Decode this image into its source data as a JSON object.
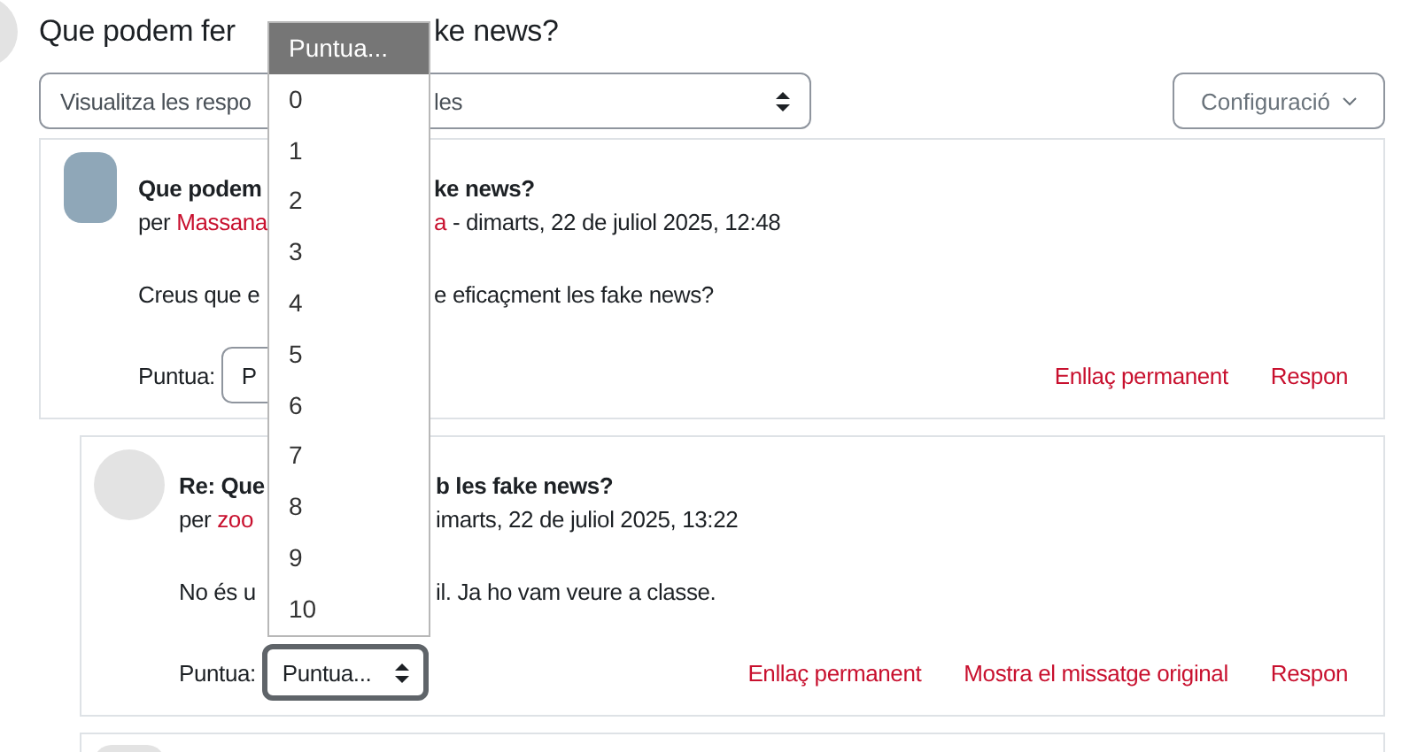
{
  "page_title": [
    "Que podem fer",
    "ke news?"
  ],
  "display_select": [
    "Visualitza les respo",
    "les"
  ],
  "settings_button": "Configuració",
  "posts": [
    {
      "photo": true,
      "subject": [
        "Que podem",
        "ke news?"
      ],
      "byline": {
        "prefix": "per",
        "author": "Massana",
        "author_end": "a",
        "date": " - dimarts, 22 de juliol 2025, 12:48"
      },
      "body": [
        "Creus que e",
        "e eficaçment les fake news?"
      ],
      "rating": {
        "label": "Puntua:",
        "value": "P",
        "focused": false
      },
      "actions": [
        "Enllaç permanent",
        "Respon"
      ],
      "children": [
        {
          "photo": false,
          "subject": [
            "Re: Que",
            "b les fake news?"
          ],
          "byline": {
            "prefix": "per",
            "author": "zoo",
            "date": "imarts, 22 de juliol 2025, 13:22"
          },
          "body": [
            "No és u",
            "il. Ja ho vam veure a classe."
          ],
          "rating": {
            "label": "Puntua:",
            "value": "Puntua...",
            "focused": true
          },
          "actions": [
            "Enllaç permanent",
            "Mostra el missatge original",
            "Respon"
          ]
        },
        {
          "photo": false,
          "cut_off": true
        }
      ]
    }
  ],
  "rating_menu": {
    "options": [
      {
        "label": "Puntua...",
        "selected": true
      },
      {
        "label": "0",
        "selected": false
      },
      {
        "label": "1",
        "selected": false
      },
      {
        "label": "2",
        "selected": false
      },
      {
        "label": "3",
        "selected": false
      },
      {
        "label": "4",
        "selected": false
      },
      {
        "label": "5",
        "selected": false
      },
      {
        "label": "6",
        "selected": false
      },
      {
        "label": "7",
        "selected": false
      },
      {
        "label": "8",
        "selected": false
      },
      {
        "label": "9",
        "selected": false
      },
      {
        "label": "10",
        "selected": false
      }
    ]
  }
}
